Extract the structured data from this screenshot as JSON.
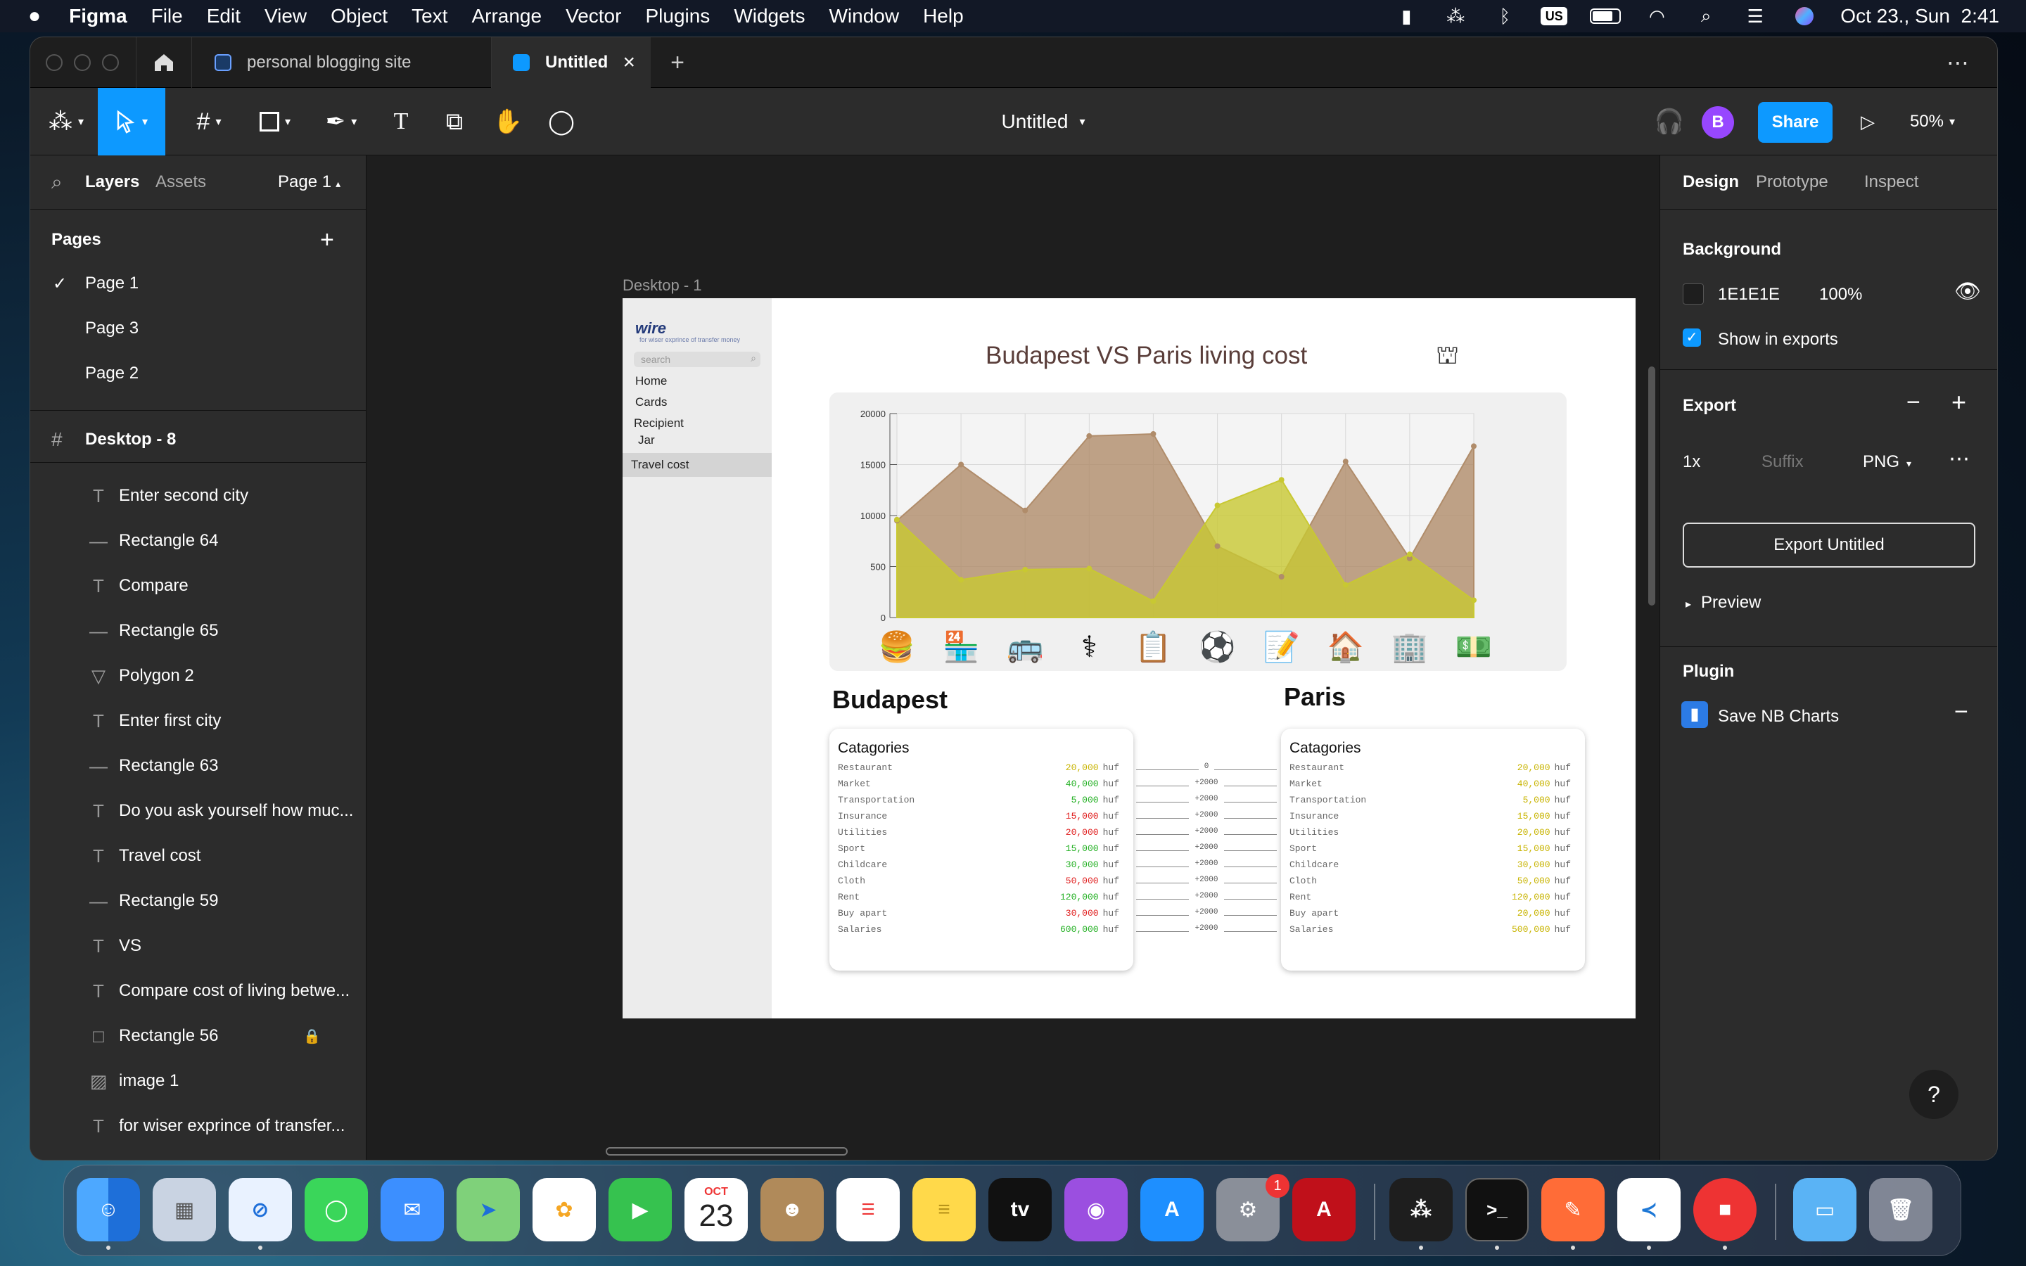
{
  "menubar": {
    "app": "Figma",
    "items": [
      "File",
      "Edit",
      "View",
      "Object",
      "Text",
      "Arrange",
      "Vector",
      "Plugins",
      "Widgets",
      "Window",
      "Help"
    ],
    "datetime": "Oct 23., Sun  2:41",
    "input_badge": "US"
  },
  "tabs": [
    {
      "label": "personal blogging site"
    },
    {
      "label": "Untitled",
      "close": "×"
    }
  ],
  "new_tab": "+",
  "more": "⋯",
  "toolbar": {
    "file_title": "Untitled",
    "avatar": "B",
    "share": "Share",
    "zoom": "50%"
  },
  "left": {
    "tab_layers": "Layers",
    "tab_assets": "Assets",
    "page_select": "Page 1",
    "pages_heading": "Pages",
    "add": "+",
    "pages": [
      {
        "label": "Page 1",
        "checked": true
      },
      {
        "label": "Page 3"
      },
      {
        "label": "Page 2"
      }
    ],
    "frame_name": "Desktop - 8",
    "layers": [
      {
        "label": "Enter second city",
        "icon": "T"
      },
      {
        "label": "Rectangle 64",
        "icon": "—"
      },
      {
        "label": "Compare",
        "icon": "T"
      },
      {
        "label": "Rectangle 65",
        "icon": "—"
      },
      {
        "label": "Polygon 2",
        "icon": "▽"
      },
      {
        "label": "Enter first city",
        "icon": "T"
      },
      {
        "label": "Rectangle 63",
        "icon": "—"
      },
      {
        "label": "Do you ask yourself how muc...",
        "icon": "T"
      },
      {
        "label": "Travel cost",
        "icon": "T"
      },
      {
        "label": "Rectangle 59",
        "icon": "—"
      },
      {
        "label": "VS",
        "icon": "T"
      },
      {
        "label": "Compare cost of living betwe...",
        "icon": "T"
      },
      {
        "label": "Rectangle 56",
        "icon": "□"
      },
      {
        "label": "image 1",
        "icon": "▨"
      },
      {
        "label": "for wiser exprince of transfer...",
        "icon": "T"
      }
    ]
  },
  "right": {
    "tab_design": "Design",
    "tab_prototype": "Prototype",
    "tab_inspect": "Inspect",
    "background_heading": "Background",
    "bg_hex": "1E1E1E",
    "bg_opacity": "100%",
    "show_exports": "Show in exports",
    "export_heading": "Export",
    "export_scale": "1x",
    "export_suffix_placeholder": "Suffix",
    "export_format": "PNG",
    "export_button": "Export Untitled",
    "preview": "Preview",
    "plugin_heading": "Plugin",
    "plugin_name": "Save NB Charts",
    "help": "?"
  },
  "canvas": {
    "frame_label": "Desktop - 1",
    "design": {
      "logo": "wire",
      "tagline": "for wiser exprince of transfer money",
      "search_placeholder": "search",
      "nav": [
        "Home",
        "Cards",
        "Recipient",
        "Jar",
        "Travel cost"
      ],
      "title": "Budapest VS Paris living cost",
      "city1": "Budapest",
      "city2": "Paris",
      "categories_heading": "Catagories",
      "rows": [
        {
          "name": "Restaurant",
          "b": "20,000",
          "p": "20,000",
          "diff": "0"
        },
        {
          "name": "Market",
          "b": "40,000",
          "p": "40,000",
          "diff": "+2000"
        },
        {
          "name": "Transportation",
          "b": "5,000",
          "p": "5,000",
          "diff": "+2000"
        },
        {
          "name": "Insurance",
          "b": "15,000",
          "p": "15,000",
          "diff": "+2000"
        },
        {
          "name": "Utilities",
          "b": "20,000",
          "p": "20,000",
          "diff": "+2000"
        },
        {
          "name": "Sport",
          "b": "15,000",
          "p": "15,000",
          "diff": "+2000"
        },
        {
          "name": "Childcare",
          "b": "30,000",
          "p": "30,000",
          "diff": "+2000"
        },
        {
          "name": "Cloth",
          "b": "50,000",
          "p": "50,000",
          "diff": "+2000"
        },
        {
          "name": "Rent",
          "b": "120,000",
          "p": "120,000",
          "diff": "+2000"
        },
        {
          "name": "Buy apart",
          "b": "30,000",
          "p": "20,000",
          "diff": "+2000"
        },
        {
          "name": "Salaries",
          "b": "600,000",
          "p": "500,000",
          "diff": "+2000"
        }
      ],
      "b_colors": [
        "#c8b400",
        "#23b023",
        "#23b023",
        "#e02020",
        "#e02020",
        "#23b023",
        "#23b023",
        "#e02020",
        "#23b023",
        "#e02020",
        "#23b023"
      ],
      "unit": "huf",
      "p_color": "#c8b400"
    }
  },
  "chart_data": {
    "type": "area",
    "title": "",
    "xlabel": "",
    "ylabel": "",
    "y_ticks": [
      "0",
      "500",
      "10000",
      "15000",
      "20000"
    ],
    "categories": [
      "restaurant",
      "market",
      "transportation",
      "insurance",
      "utilities",
      "sport",
      "childcare",
      "cloth",
      "rent",
      "buy apart"
    ],
    "series": [
      {
        "color": "#b08c6a",
        "values": [
          9500,
          15000,
          10500,
          17800,
          18000,
          7000,
          4000,
          15300,
          5800,
          16800
        ]
      },
      {
        "color": "#c8c832",
        "values": [
          9600,
          3700,
          4700,
          4800,
          1600,
          11000,
          13500,
          3200,
          6200,
          1700
        ]
      }
    ],
    "ylim": [
      0,
      20000
    ],
    "grid": true
  },
  "dock": {
    "calendar_month": "OCT",
    "calendar_day": "23",
    "badge": "1",
    "apps": [
      "Finder",
      "Launchpad",
      "Safari",
      "Messages",
      "Mail",
      "Maps",
      "Photos",
      "FaceTime",
      "Calendar",
      "Contacts",
      "Reminders",
      "Notes",
      "TV",
      "Podcasts",
      "App Store",
      "System Settings",
      "AutoCAD",
      "Figma",
      "Terminal",
      "Postman",
      "VS Code",
      "Zoom",
      "Folder",
      "Trash"
    ]
  }
}
